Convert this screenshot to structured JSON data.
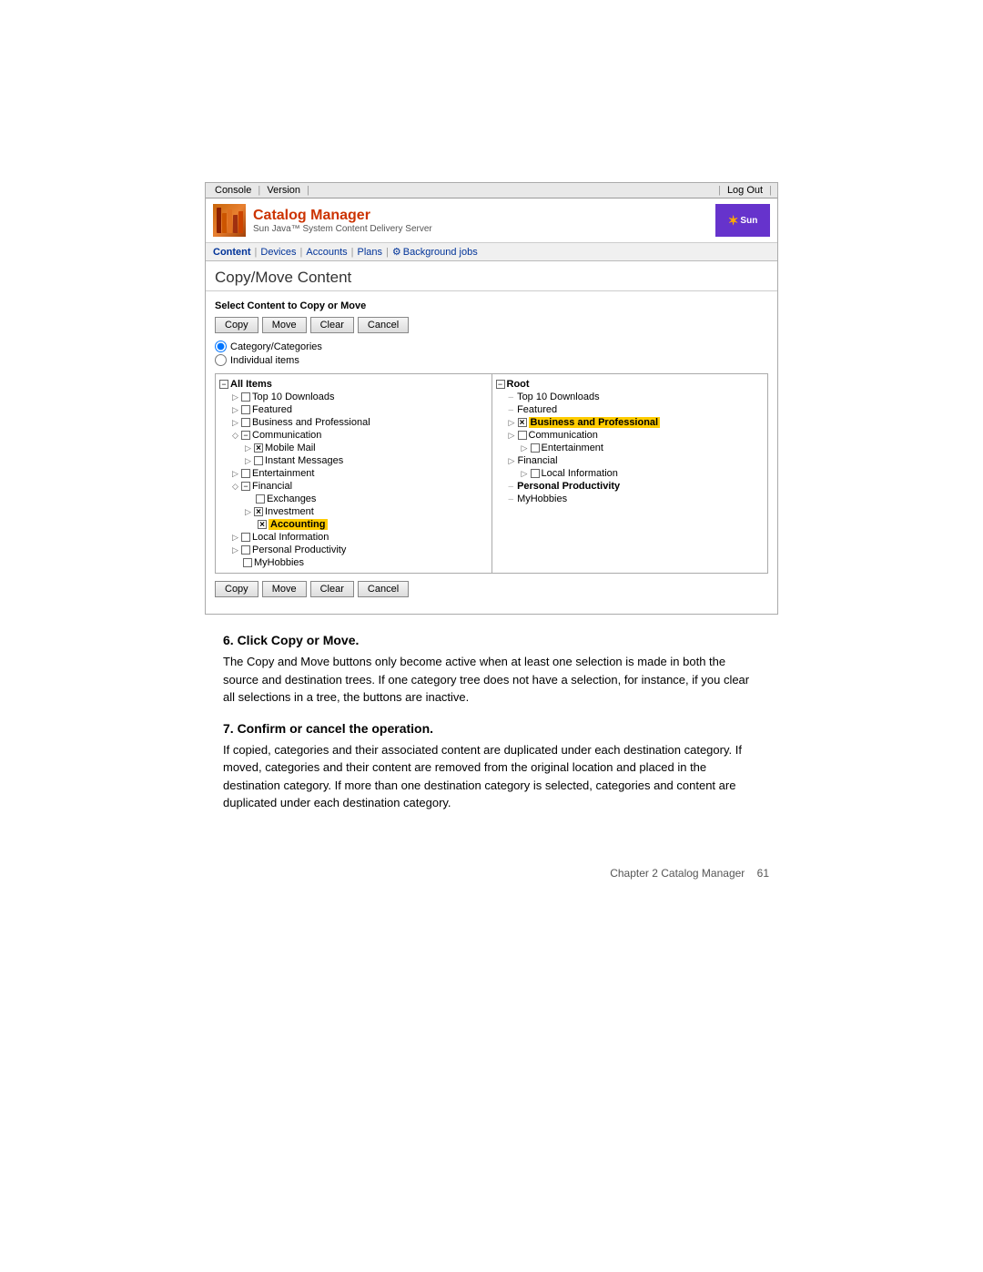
{
  "topnav": {
    "console": "Console",
    "version": "Version",
    "logout": "Log Out"
  },
  "header": {
    "title": "Catalog Manager",
    "subtitle": "Sun Java™ System Content Delivery Server",
    "sun_label": "Sun"
  },
  "secondnav": {
    "items": [
      {
        "label": "Content",
        "active": true
      },
      {
        "label": "Devices"
      },
      {
        "label": "Accounts"
      },
      {
        "label": "Plans"
      },
      {
        "label": "Background jobs",
        "icon": "gear"
      }
    ]
  },
  "page": {
    "title": "Copy/Move Content",
    "select_label": "Select Content to Copy or Move"
  },
  "buttons_top": {
    "copy": "Copy",
    "move": "Move",
    "clear": "Clear",
    "cancel": "Cancel"
  },
  "buttons_bottom": {
    "copy": "Copy",
    "move": "Move",
    "clear": "Clear",
    "cancel": "Cancel"
  },
  "radio": {
    "option1": "Category/Categories",
    "option2": "Individual items"
  },
  "source_tree": {
    "header": "All Items",
    "items": [
      {
        "label": "Top 10 Downloads",
        "indent": 1,
        "type": "expand",
        "checked": false
      },
      {
        "label": "Featured",
        "indent": 1,
        "type": "expand",
        "checked": false
      },
      {
        "label": "Business and Professional",
        "indent": 1,
        "type": "expand",
        "checked": false
      },
      {
        "label": "Communication",
        "indent": 1,
        "type": "expand-open",
        "checked": false
      },
      {
        "label": "Mobile Mail",
        "indent": 2,
        "type": "expand",
        "checked": true
      },
      {
        "label": "Instant Messages",
        "indent": 2,
        "type": "none",
        "checked": false
      },
      {
        "label": "Entertainment",
        "indent": 1,
        "type": "expand",
        "checked": false
      },
      {
        "label": "Financial",
        "indent": 1,
        "type": "expand-open",
        "checked": false
      },
      {
        "label": "Exchanges",
        "indent": 2,
        "type": "none",
        "checked": false
      },
      {
        "label": "Investment",
        "indent": 2,
        "type": "expand",
        "checked": true
      },
      {
        "label": "Accounting",
        "indent": 3,
        "type": "none",
        "checked": true,
        "bold": true
      },
      {
        "label": "Local Information",
        "indent": 1,
        "type": "expand",
        "checked": false
      },
      {
        "label": "Personal Productivity",
        "indent": 1,
        "type": "expand",
        "checked": false
      },
      {
        "label": "MyHobbies",
        "indent": 1,
        "type": "none",
        "checked": false
      }
    ]
  },
  "dest_tree": {
    "header": "Root",
    "items": [
      {
        "label": "Top 10 Downloads",
        "indent": 0,
        "type": "dash"
      },
      {
        "label": "Featured",
        "indent": 0,
        "type": "dash"
      },
      {
        "label": "Business and Professional",
        "indent": 0,
        "type": "expand",
        "checked": true,
        "highlighted": true
      },
      {
        "label": "Communication",
        "indent": 0,
        "type": "expand",
        "checked": false
      },
      {
        "label": "Entertainment",
        "indent": 1,
        "type": "expand",
        "checked": false
      },
      {
        "label": "Financial",
        "indent": 0,
        "type": "expand"
      },
      {
        "label": "Local Information",
        "indent": 1,
        "type": "none",
        "checked": false
      },
      {
        "label": "Personal Productivity",
        "indent": 0,
        "type": "dash",
        "bold": true
      },
      {
        "label": "MyHobbies",
        "indent": 0,
        "type": "dash"
      }
    ]
  },
  "instructions": [
    {
      "number": "6.",
      "title": "Click Copy or Move.",
      "text": "The Copy and Move buttons only become active when at least one selection is made in both the source and destination trees. If one category tree does not have a selection, for instance, if you clear all selections in a tree, the buttons are inactive."
    },
    {
      "number": "7.",
      "title": "Confirm or cancel the operation.",
      "text": "If copied, categories and their associated content are duplicated under each destination category. If moved, categories and their content are removed from the original location and placed in the destination category. If more than one destination category is selected, categories and content are duplicated under each destination category."
    }
  ],
  "footer": {
    "text": "Chapter 2   Catalog Manager",
    "page": "61"
  }
}
